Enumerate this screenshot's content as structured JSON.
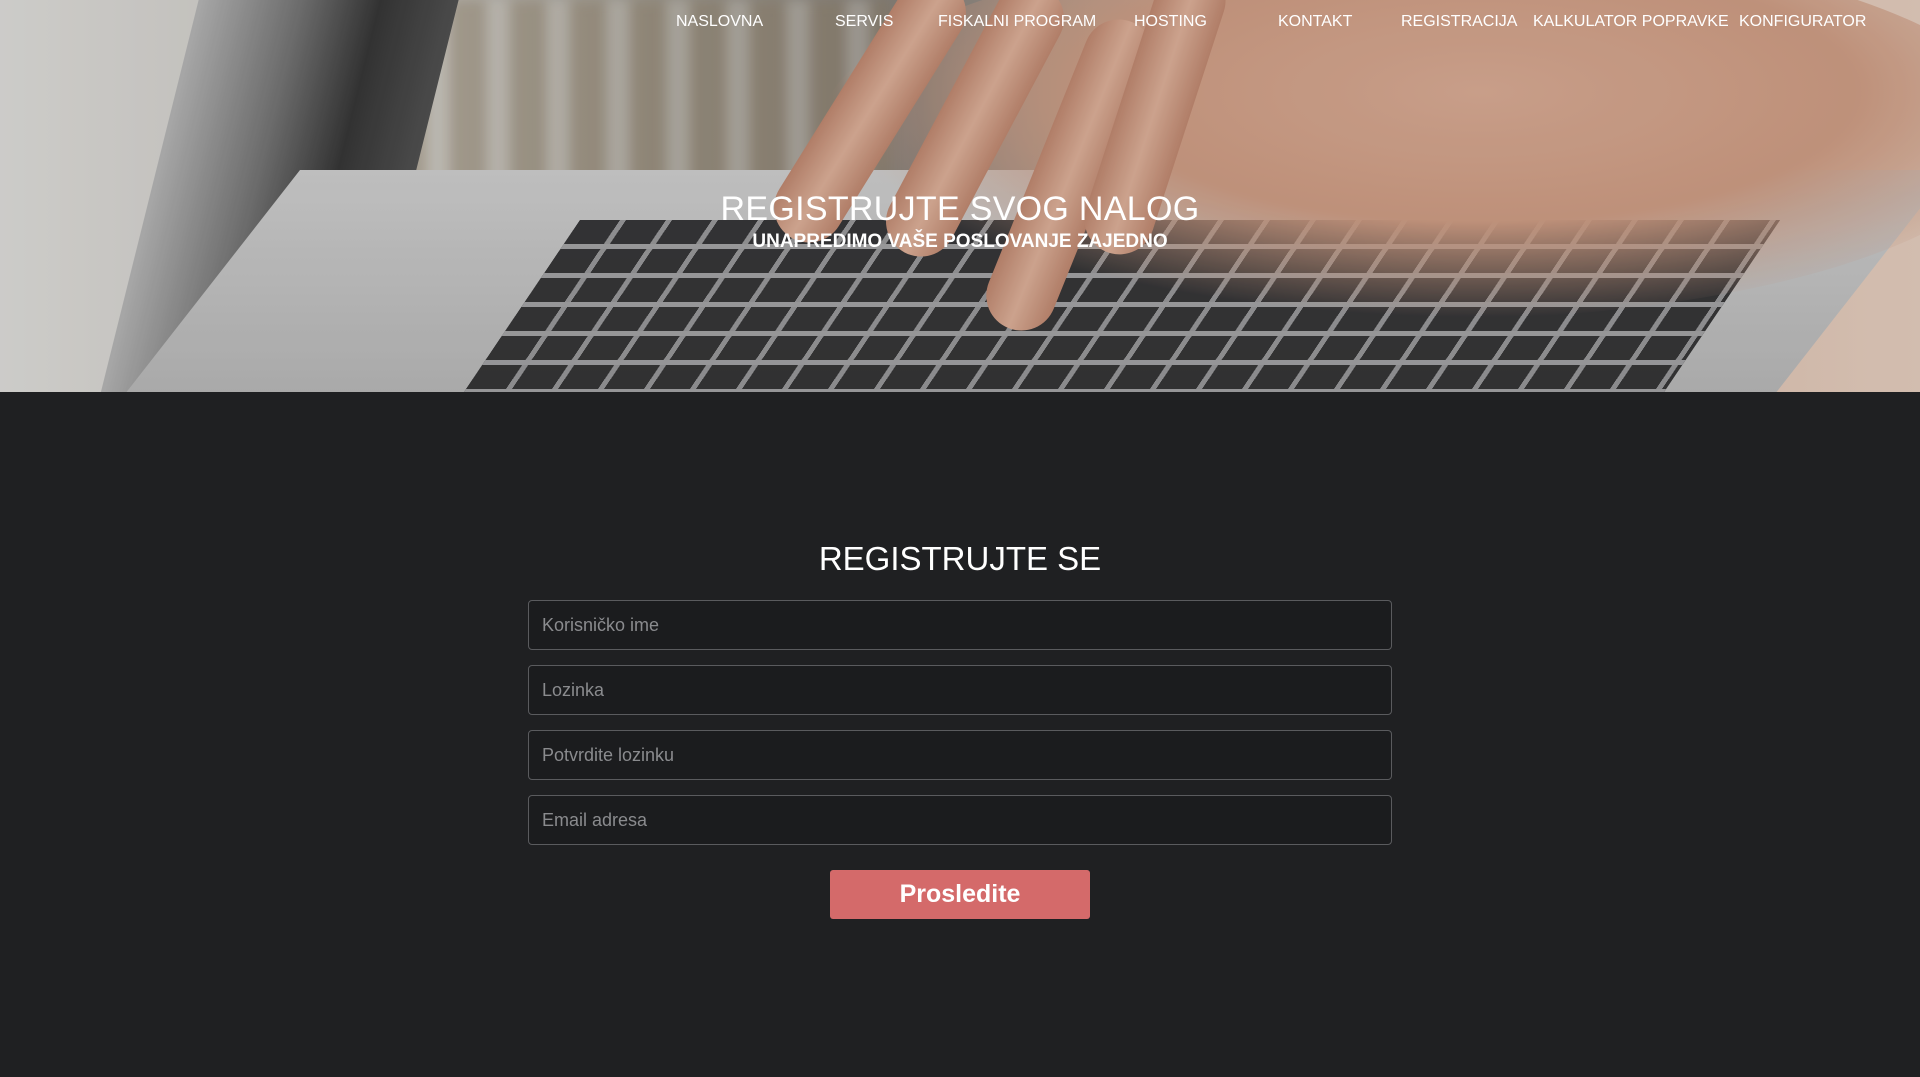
{
  "nav": {
    "items": [
      {
        "label": "NASLOVNA"
      },
      {
        "label": "SERVIS"
      },
      {
        "label": "FISKALNI PROGRAM"
      },
      {
        "label": "HOSTING"
      },
      {
        "label": "KONTAKT"
      },
      {
        "label": "REGISTRACIJA"
      },
      {
        "label": "KALKULATOR POPRAVKE"
      },
      {
        "label": "KONFIGURATOR"
      }
    ]
  },
  "hero": {
    "title": "REGISTRUJTE SVOG NALOG",
    "subtitle": "UNAPREDIMO VAŠE POSLOVANJE ZAJEDNO"
  },
  "form": {
    "title": "REGISTRUJTE SE",
    "username_placeholder": "Korisničko ime",
    "password_placeholder": "Lozinka",
    "confirm_placeholder": "Potvrdite lozinku",
    "email_placeholder": "Email adresa",
    "submit_label": "Prosledite"
  },
  "colors": {
    "page_background": "#1f2022",
    "button": "#d46a6a",
    "text": "#ffffff"
  }
}
